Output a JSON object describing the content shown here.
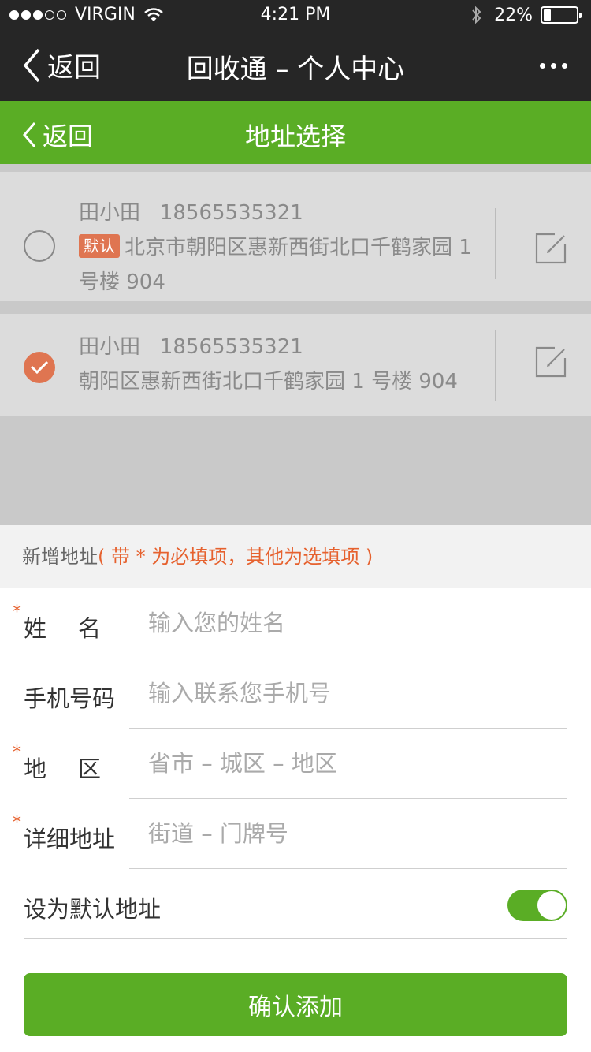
{
  "status_bar": {
    "carrier": "VIRGIN",
    "time": "4:21 PM",
    "battery": "22%",
    "battery_level": 0.22,
    "icons": [
      "signal-dots",
      "wifi-icon",
      "bluetooth-icon",
      "battery-icon"
    ]
  },
  "nav_main": {
    "back_label": "返回",
    "title": "回收通 – 个人中心",
    "more_icon": "more-dots-icon"
  },
  "nav_sub": {
    "back_label": "返回",
    "title": "地址选择"
  },
  "addresses": [
    {
      "name": "田小田",
      "phone": "18565535321",
      "badge": "默认",
      "address": "北京市朝阳区惠新西街北口千鹤家园 1 号楼 904",
      "selected": false
    },
    {
      "name": "田小田",
      "phone": "18565535321",
      "address": "朝阳区惠新西街北口千鹤家园 1 号楼 904",
      "selected": true
    }
  ],
  "new_address": {
    "header_label": "新增地址",
    "header_note": "( 带 * 为必填项，其他为选填项 )",
    "required_mark": "*",
    "fields": [
      {
        "label": "姓名",
        "placeholder": "输入您的姓名",
        "value": "",
        "required": true
      },
      {
        "label": "手机号码",
        "placeholder": "输入联系您手机号",
        "value": "",
        "required": false
      },
      {
        "label": "地区",
        "placeholder": "省市 – 城区 – 地区",
        "value": "",
        "required": true
      },
      {
        "label": "详细地址",
        "placeholder": "街道 – 门牌号",
        "value": "",
        "required": true
      }
    ],
    "default_toggle_label": "设为默认地址",
    "default_toggle_on": true
  },
  "confirm_label": "确认添加",
  "colors": {
    "dark_bar": "#262626",
    "green": "#5aad25",
    "accent_orange": "#df7551",
    "note_orange": "#e6612e"
  }
}
